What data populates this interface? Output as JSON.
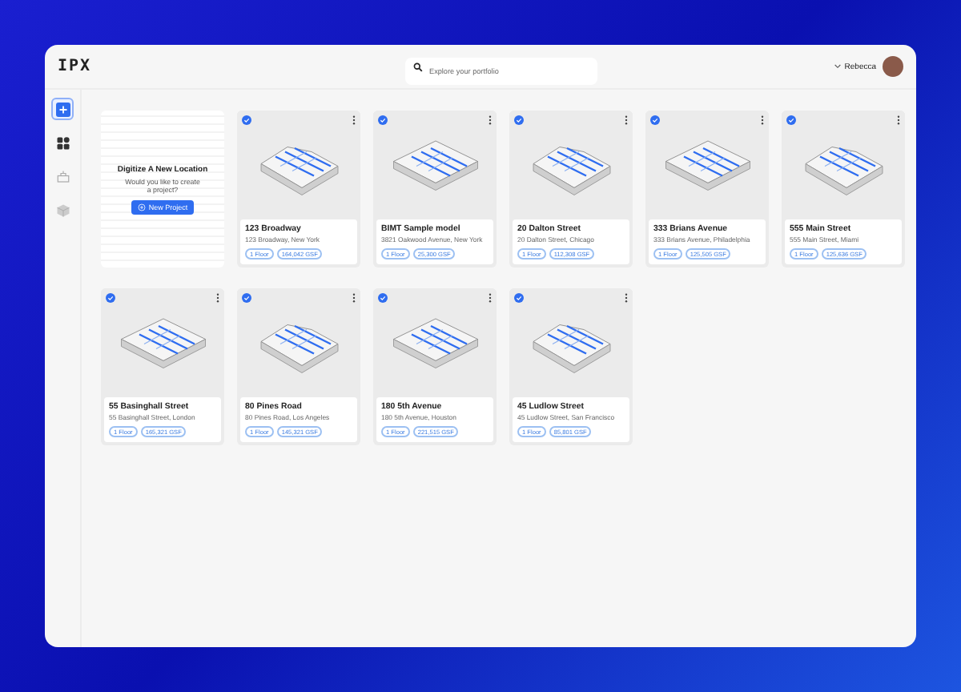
{
  "header": {
    "logo": "IPX",
    "search": {
      "placeholder": "Explore your portfolio"
    },
    "user": {
      "name": "Rebecca"
    }
  },
  "sidebar": {
    "items": [
      {
        "kind": "add",
        "selected": true
      },
      {
        "kind": "grid",
        "selected": false
      },
      {
        "kind": "sites",
        "selected": false
      },
      {
        "kind": "cube",
        "selected": false
      }
    ]
  },
  "new_location": {
    "title": "Digitize A New Location",
    "text": "Would you like to create a project?",
    "button": "New Project"
  },
  "projects": [
    {
      "name": "123 Broadway",
      "address": "123 Broadway, New York",
      "floors": "1 Floor",
      "area": "164,042 GSF",
      "checked": true
    },
    {
      "name": "BIMT Sample model",
      "address": "3821 Oakwood Avenue, New York",
      "floors": "1 Floor",
      "area": "25,300 GSF",
      "checked": true
    },
    {
      "name": "20 Dalton Street",
      "address": "20 Dalton Street, Chicago",
      "floors": "1 Floor",
      "area": "112,308 GSF",
      "checked": true
    },
    {
      "name": "333 Brians Avenue",
      "address": "333 Brians Avenue, Philadelphia",
      "floors": "1 Floor",
      "area": "125,505 GSF",
      "checked": true
    },
    {
      "name": "555 Main Street",
      "address": "555 Main Street, Miami",
      "floors": "1 Floor",
      "area": "125,636 GSF",
      "checked": true
    },
    {
      "name": "55 Basinghall Street",
      "address": "55 Basinghall Street, London",
      "floors": "1 Floor",
      "area": "165,321 GSF",
      "checked": true
    },
    {
      "name": "80 Pines Road",
      "address": "80 Pines Road, Los Angeles",
      "floors": "1 Floor",
      "area": "145,321 GSF",
      "checked": true
    },
    {
      "name": "180 5th Avenue",
      "address": "180 5th Avenue, Houston",
      "floors": "1 Floor",
      "area": "221,515 GSF",
      "checked": true
    },
    {
      "name": "45 Ludlow Street",
      "address": "45 Ludlow Street, San Francisco",
      "floors": "1 Floor",
      "area": "85,801 GSF",
      "checked": true
    }
  ]
}
